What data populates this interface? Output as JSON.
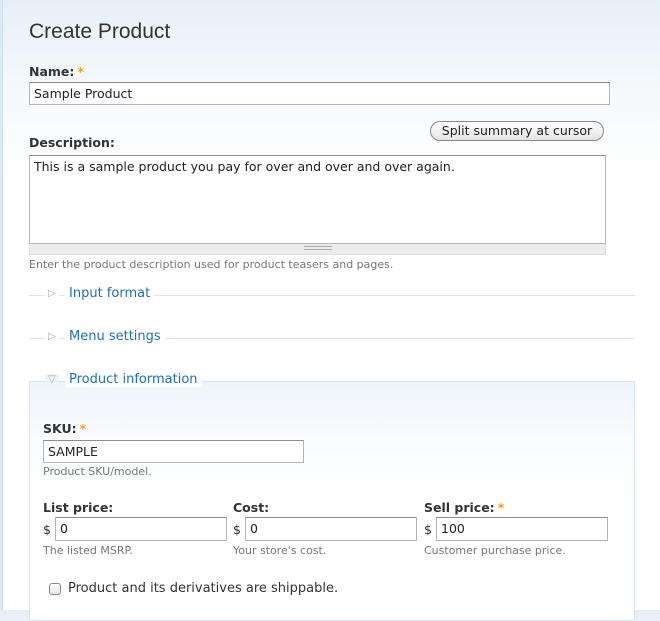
{
  "page": {
    "title": "Create Product"
  },
  "name": {
    "label": "Name:",
    "required": "*",
    "value": "Sample Product"
  },
  "split_button": "Split summary at cursor",
  "description": {
    "label": "Description:",
    "value": "This is a sample product you pay for over and over and over again.",
    "help": "Enter the product description used for product teasers and pages."
  },
  "fieldsets": [
    {
      "label": "Input format",
      "collapsed": true
    },
    {
      "label": "Menu settings",
      "collapsed": true
    },
    {
      "label": "Product information",
      "collapsed": false
    }
  ],
  "product": {
    "sku": {
      "label": "SKU:",
      "required": "*",
      "value": "SAMPLE",
      "help": "Product SKU/model."
    },
    "list_price": {
      "label": "List price:",
      "currency": "$",
      "value": "0",
      "help": "The listed MSRP."
    },
    "cost": {
      "label": "Cost:",
      "currency": "$",
      "value": "0",
      "help": "Your store's cost."
    },
    "sell_price": {
      "label": "Sell price:",
      "required": "*",
      "currency": "$",
      "value": "100",
      "help": "Customer purchase price."
    },
    "shippable": {
      "label": "Product and its derivatives are shippable.",
      "checked": false
    }
  }
}
